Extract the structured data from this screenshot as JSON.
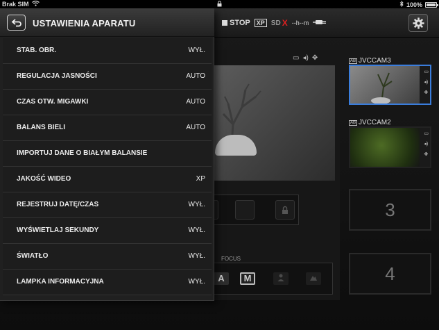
{
  "status_bar": {
    "carrier": "Brak SIM",
    "battery_percent": "100%"
  },
  "app_header": {
    "record_status": "STOP",
    "quality_badge": "XP",
    "sd_label": "SD",
    "sd_error_mark": "X",
    "remaining_time": "--h--m"
  },
  "cameras": [
    {
      "label": "JVCCAM3",
      "selected": true
    },
    {
      "label": "JVCCAM2",
      "selected": false
    }
  ],
  "camera_badge": "AB",
  "empty_slots": [
    "3",
    "4"
  ],
  "focus": {
    "label": "FOCUS",
    "modes": [
      "A",
      "M"
    ]
  },
  "settings": {
    "title": "USTAWIENIA APARATU",
    "items": [
      {
        "label": "STAB. OBR.",
        "value": "WYŁ."
      },
      {
        "label": "REGULACJA JASNOŚCI",
        "value": "AUTO"
      },
      {
        "label": "CZAS OTW. MIGAWKI",
        "value": "AUTO"
      },
      {
        "label": "BALANS BIELI",
        "value": "AUTO"
      },
      {
        "label": "IMPORTUJ DANE O BIAŁYM BALANSIE",
        "value": ""
      },
      {
        "label": "JAKOŚĆ WIDEO",
        "value": "XP"
      },
      {
        "label": "REJESTRUJ DATĘ/CZAS",
        "value": "WYŁ."
      },
      {
        "label": "WYŚWIETLAJ SEKUNDY",
        "value": "WYŁ."
      },
      {
        "label": "ŚWIATŁO",
        "value": "WYŁ."
      },
      {
        "label": "LAMPKA INFORMACYJNA",
        "value": "WYŁ."
      }
    ]
  },
  "colors": {
    "selected_border": "#3a7ddc",
    "sd_error": "#e02020"
  }
}
